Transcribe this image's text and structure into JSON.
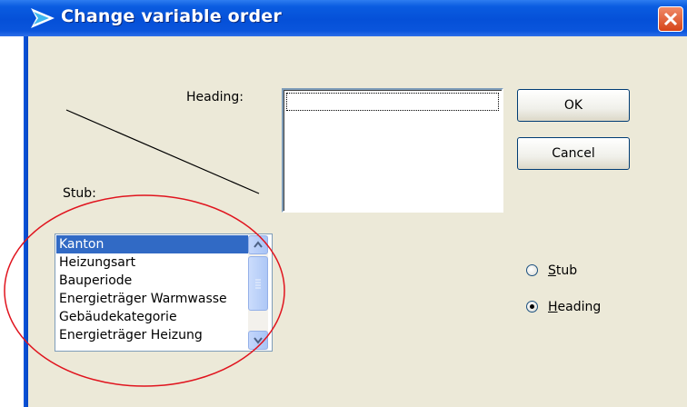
{
  "window": {
    "title": "Change variable order",
    "close_icon": "close-x-icon"
  },
  "labels": {
    "heading": "Heading:",
    "stub": "Stub:"
  },
  "buttons": {
    "ok": "OK",
    "cancel": "Cancel"
  },
  "heading_list": {
    "items": []
  },
  "stub_list": {
    "items": [
      "Kanton",
      "Heizungsart",
      "Bauperiode",
      "Energieträger Warmwasse",
      "Gebäudekategorie",
      "Energieträger Heizung"
    ],
    "selected_index": 0
  },
  "radio": {
    "stub_accel": "S",
    "stub_rest": "tub",
    "heading_accel": "H",
    "heading_rest": "eading",
    "selected": "Heading"
  },
  "annotation": {
    "color": "#e0141e"
  }
}
